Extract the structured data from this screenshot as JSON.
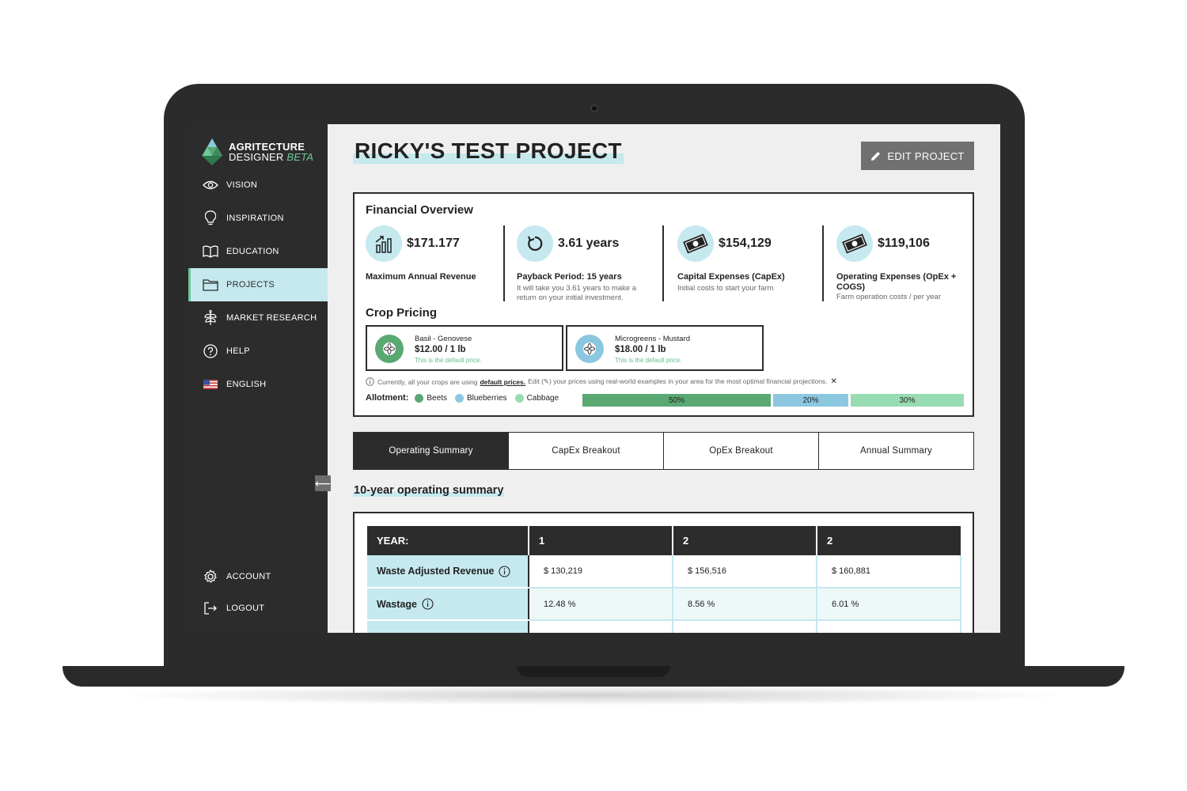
{
  "brand": {
    "line1": "AGRITECTURE",
    "line2": "DESIGNER",
    "beta": "BETA"
  },
  "sidebar": {
    "items": [
      {
        "label": "VISION",
        "icon": "eye-icon"
      },
      {
        "label": "INSPIRATION",
        "icon": "lightbulb-icon"
      },
      {
        "label": "EDUCATION",
        "icon": "book-icon"
      },
      {
        "label": "PROJECTS",
        "icon": "folder-icon",
        "active": true
      },
      {
        "label": "MARKET RESEARCH",
        "icon": "plant-icon"
      },
      {
        "label": "HELP",
        "icon": "question-icon"
      },
      {
        "label": "ENGLISH",
        "icon": "us-flag-icon"
      }
    ],
    "bottom": [
      {
        "label": "ACCOUNT",
        "icon": "gear-icon"
      },
      {
        "label": "LOGOUT",
        "icon": "logout-icon"
      }
    ],
    "collapse_glyph": "⟵"
  },
  "page": {
    "title": "RICKY'S TEST PROJECT",
    "edit_label": "EDIT PROJECT"
  },
  "financial": {
    "heading": "Financial Overview",
    "metrics": [
      {
        "value": "$171.177",
        "label": "Maximum Annual Revenue",
        "desc": "",
        "icon": "bar-chart-icon"
      },
      {
        "value": "3.61 years",
        "label": "Payback Period: 15 years",
        "desc": "It will take you 3.61 years to make a return on your initial investment.",
        "icon": "refresh-icon"
      },
      {
        "value": "$154,129",
        "label": "Capital Expenses (CapEx)",
        "desc": "Initial costs to start your farm",
        "icon": "money-icon"
      },
      {
        "value": "$119,106",
        "label": "Operating Expenses (OpEx + COGS)",
        "desc": "Farm operation costs / per year",
        "icon": "money-icon"
      }
    ]
  },
  "crops": {
    "heading": "Crop Pricing",
    "items": [
      {
        "name": "Basil - Genovese",
        "price": "$12.00 / 1 lb",
        "note": "This is the default price.",
        "color": "#5aa872"
      },
      {
        "name": "Microgreens - Mustard",
        "price": "$18.00 / 1 lb",
        "note": "This is the default price.",
        "color": "#8cc7e0"
      }
    ],
    "info_pre": "Currently, all your crops are using",
    "info_link": "default prices.",
    "info_post": "Edit (✎) your prices using real-world examples in your area for the most optimal financial projections.",
    "close_glyph": "✕"
  },
  "allotment": {
    "label": "Allotment:",
    "items": [
      {
        "name": "Beets",
        "percent": "50%",
        "share": 0.5,
        "color": "#5aa872"
      },
      {
        "name": "Blueberries",
        "percent": "20%",
        "share": 0.2,
        "color": "#8cc7e0"
      },
      {
        "name": "Cabbage",
        "percent": "30%",
        "share": 0.3,
        "color": "#97dcb2"
      }
    ]
  },
  "tabs": [
    "Operating Summary",
    "CapEx Breakout",
    "OpEx Breakout",
    "Annual Summary"
  ],
  "summary": {
    "title": "10-year operating summary",
    "header": [
      "YEAR:",
      "1",
      "2",
      "2"
    ],
    "rows": [
      {
        "label": "Waste Adjusted Revenue",
        "cells": [
          "$ 130,219",
          "$ 156,516",
          "$ 160,881"
        ]
      },
      {
        "label": "Wastage",
        "cells": [
          "12.48 %",
          "8.56 %",
          "6.01 %"
        ]
      }
    ]
  },
  "colors": {
    "accent": "#c5e9ee",
    "dark": "#2c2c2c",
    "green": "#6fc89a"
  }
}
